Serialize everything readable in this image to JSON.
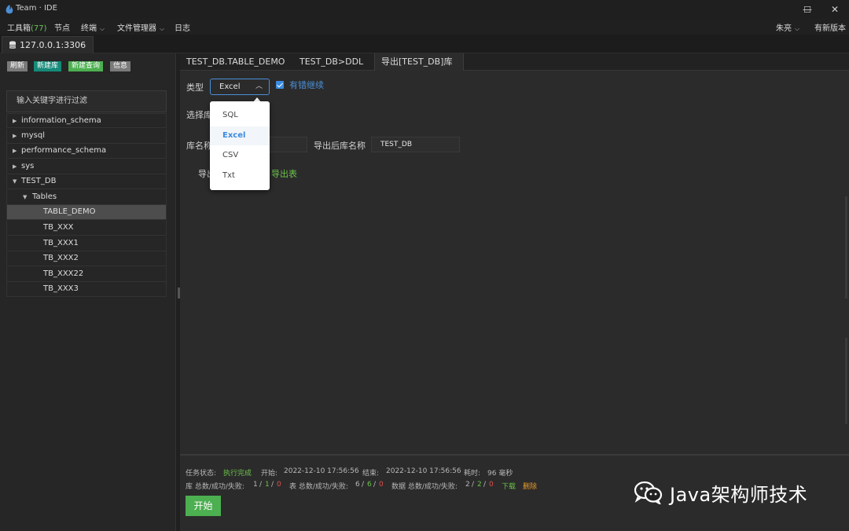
{
  "window": {
    "title": "Team · IDE",
    "min_glyph": "—",
    "max_glyph": "☐",
    "close_glyph": "✕"
  },
  "menubar": {
    "toolbox_label": "工具箱",
    "toolbox_count": "(77)",
    "node_label": "节点",
    "terminal_label": "终端",
    "file_manager_label": "文件管理器",
    "log_label": "日志",
    "user_label": "朱亮",
    "new_version_label": "有新版本"
  },
  "connection": {
    "tab_label": "127.0.0.1:3306"
  },
  "left_toolbar": {
    "refresh": "刷新",
    "new_db": "新建库",
    "new_query": "新建查询",
    "info": "信息"
  },
  "filter": {
    "placeholder": "输入关键字进行过滤"
  },
  "tree": {
    "databases": [
      "information_schema",
      "mysql",
      "performance_schema",
      "sys",
      "TEST_DB"
    ],
    "tables_label": "Tables",
    "tables": [
      "TABLE_DEMO",
      "TB_XXX",
      "TB_XXX1",
      "TB_XXX2",
      "TB_XXX22",
      "TB_XXX3"
    ]
  },
  "editor_tabs": [
    "TEST_DB.TABLE_DEMO",
    "TEST_DB>DDL",
    "导出[TEST_DB]库"
  ],
  "form": {
    "type_label": "类型",
    "type_value": "Excel",
    "continue_on_error_label": "有错继续",
    "continue_on_error_checked": true,
    "select_db_label": "选择库",
    "db_name_label": "库名称",
    "export_db_name_label": "导出后库名称",
    "export_db_name_value": "TEST_DB",
    "export_label_partial": "导出",
    "export_table_link_partial": "导出表",
    "type_options": [
      "SQL",
      "Excel",
      "CSV",
      "Txt"
    ],
    "type_selected_index": 1
  },
  "status": {
    "task_state_label": "任务状态:",
    "task_state_value": "执行完成",
    "start_label": "开始:",
    "start_value": "2022-12-10 17:56:56",
    "end_label": "结束:",
    "end_value": "2022-12-10 17:56:56",
    "duration_label": "耗时:",
    "duration_value": "96 毫秒",
    "db_stats_label": "库 总数/成功/失败:",
    "db_total": "1",
    "db_success": "1",
    "db_fail": "0",
    "table_stats_label": "表 总数/成功/失败:",
    "table_total": "6",
    "table_success": "6",
    "table_fail": "0",
    "data_stats_label": "数据 总数/成功/失败:",
    "data_total": "2",
    "data_success": "2",
    "data_fail": "0",
    "download_label": "下载",
    "delete_label": "删除",
    "slash": "/"
  },
  "start_button": "开始",
  "watermark": {
    "text": "Java架构师技术",
    "icon": "wechat-icon"
  },
  "colors": {
    "accent_blue": "#3b8be0",
    "success_green": "#4caf50",
    "fail_red": "#e04f4f",
    "warn_orange": "#e69a28",
    "new_db_btn": "#168a7a",
    "new_query_btn": "#4caf50",
    "gray_btn": "#7a7a7a"
  }
}
